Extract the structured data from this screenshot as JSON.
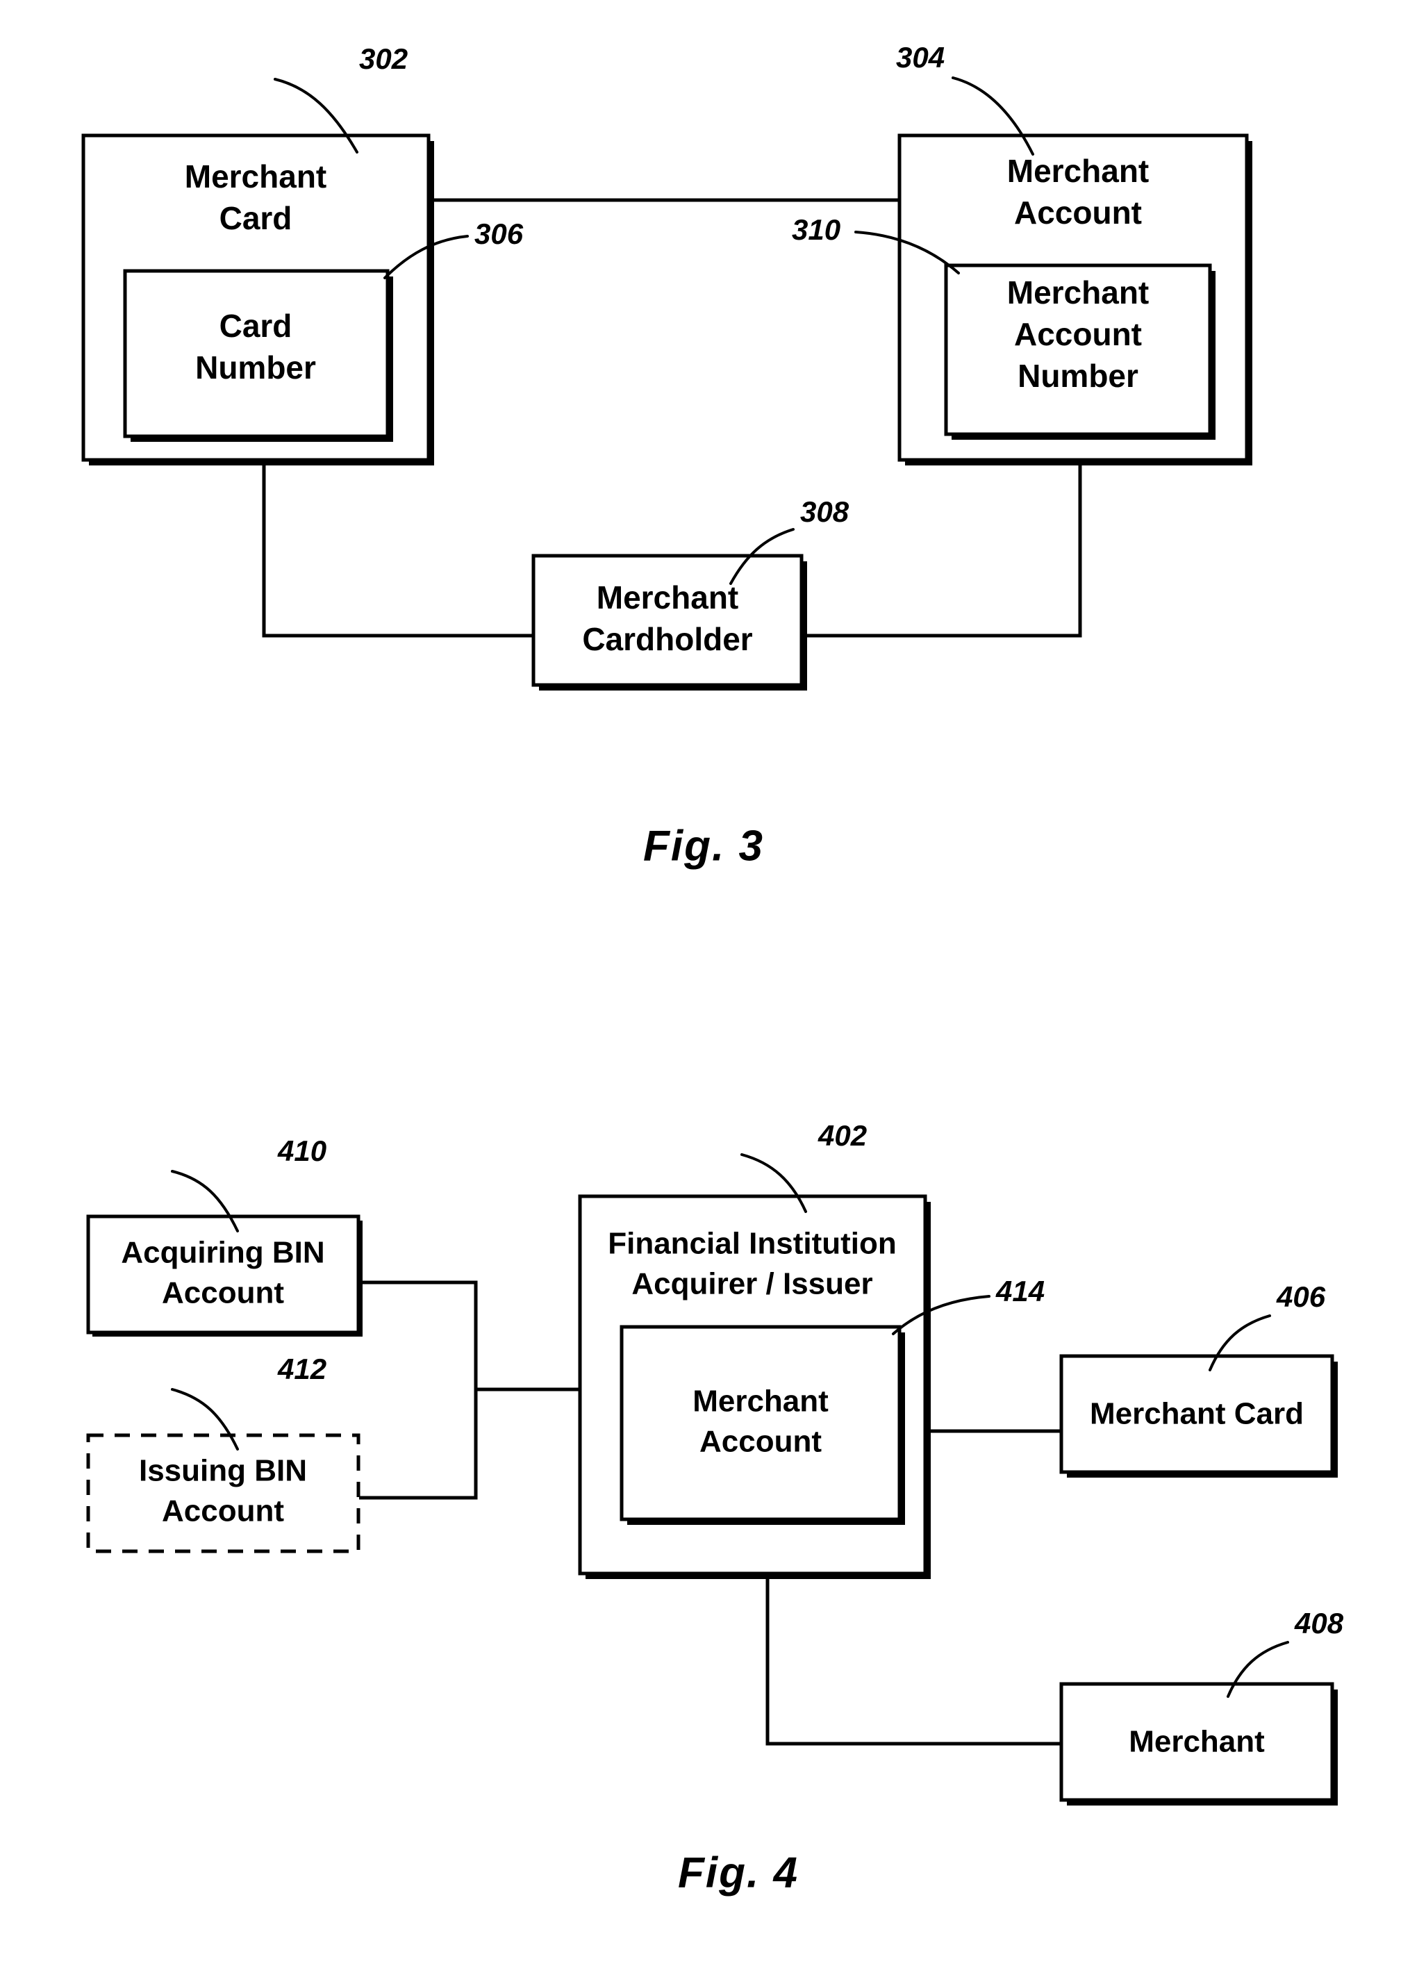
{
  "document": {
    "type": "patent-drawing-sheet",
    "figures": [
      {
        "id": "fig3",
        "caption": "Fig.  3",
        "boxes": [
          {
            "ref": "302",
            "label_line1": "Merchant",
            "label_line2": "Card"
          },
          {
            "ref": "306",
            "label_line1": "Card",
            "label_line2": "Number"
          },
          {
            "ref": "304",
            "label_line1": "Merchant",
            "label_line2": "Account"
          },
          {
            "ref": "310",
            "label_line1": "Merchant",
            "label_line2": "Account",
            "label_line3": "Number"
          },
          {
            "ref": "308",
            "label_line1": "Merchant",
            "label_line2": "Cardholder"
          }
        ]
      },
      {
        "id": "fig4",
        "caption": "Fig.  4",
        "boxes": [
          {
            "ref": "410",
            "label_line1": "Acquiring BIN",
            "label_line2": "Account",
            "border": "solid"
          },
          {
            "ref": "412",
            "label_line1": "Issuing BIN",
            "label_line2": "Account",
            "border": "dashed"
          },
          {
            "ref": "402",
            "label_line1": "Financial Institution",
            "label_line2": "Acquirer / Issuer",
            "border": "solid"
          },
          {
            "ref": "414",
            "label_line1": "Merchant",
            "label_line2": "Account",
            "border": "solid"
          },
          {
            "ref": "406",
            "label_line1": "Merchant Card",
            "border": "solid"
          },
          {
            "ref": "408",
            "label_line1": "Merchant",
            "border": "solid"
          }
        ]
      }
    ],
    "colors": {
      "ink": "#000000",
      "paper": "#ffffff"
    }
  },
  "fig3": {
    "caption": "Fig.  3",
    "merchant_card": {
      "ref": "302",
      "line1": "Merchant",
      "line2": "Card"
    },
    "card_number": {
      "ref": "306",
      "line1": "Card",
      "line2": "Number"
    },
    "merchant_account": {
      "ref": "304",
      "line1": "Merchant",
      "line2": "Account"
    },
    "merchant_account_number": {
      "ref": "310",
      "line1": "Merchant",
      "line2": "Account",
      "line3": "Number"
    },
    "merchant_cardholder": {
      "ref": "308",
      "line1": "Merchant",
      "line2": "Cardholder"
    }
  },
  "fig4": {
    "caption": "Fig.  4",
    "acquiring_bin_account": {
      "ref": "410",
      "line1": "Acquiring BIN",
      "line2": "Account"
    },
    "issuing_bin_account": {
      "ref": "412",
      "line1": "Issuing BIN",
      "line2": "Account"
    },
    "financial_institution": {
      "ref": "402",
      "line1": "Financial Institution",
      "line2": "Acquirer / Issuer"
    },
    "merchant_account": {
      "ref": "414",
      "line1": "Merchant",
      "line2": "Account"
    },
    "merchant_card": {
      "ref": "406",
      "line1": "Merchant Card"
    },
    "merchant": {
      "ref": "408",
      "line1": "Merchant"
    }
  }
}
